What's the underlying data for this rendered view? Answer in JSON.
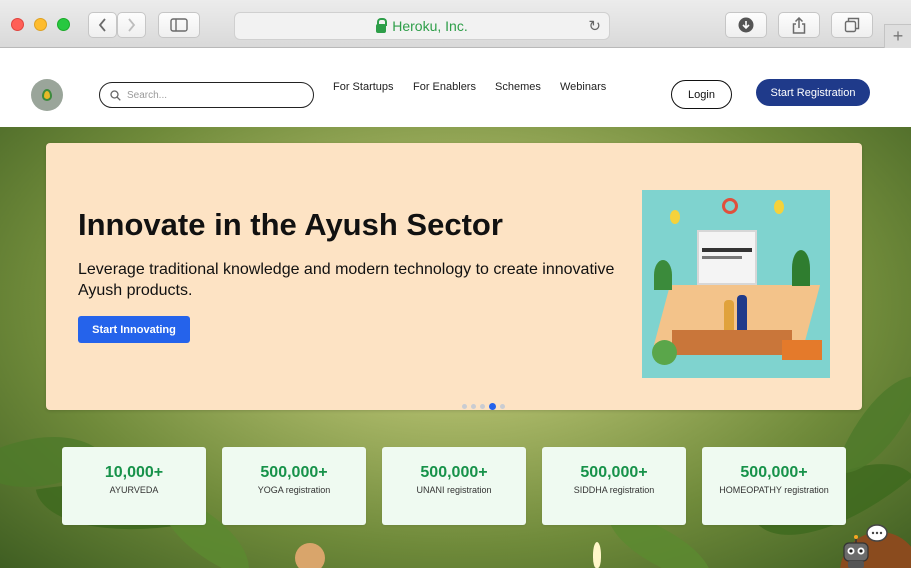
{
  "browser": {
    "address": "Heroku, Inc."
  },
  "header": {
    "search_placeholder": "Search...",
    "nav": [
      "For Startups",
      "For Enablers",
      "Schemes",
      "Webinars"
    ],
    "login_label": "Login",
    "register_label": "Start Registration"
  },
  "hero": {
    "title": "Innovate in the Ayush Sector",
    "description": "Leverage traditional knowledge and modern technology to create innovative Ayush products.",
    "cta_label": "Start Innovating",
    "slides_count": 5,
    "active_slide": 4
  },
  "stats": [
    {
      "value": "10,000+",
      "label": "AYURVEDA"
    },
    {
      "value": "500,000+",
      "label": "YOGA registration"
    },
    {
      "value": "500,000+",
      "label": "UNANI registration"
    },
    {
      "value": "500,000+",
      "label": "SIDDHA registration"
    },
    {
      "value": "500,000+",
      "label": "HOMEOPATHY registration"
    }
  ],
  "colors": {
    "primary_blue": "#2563eb",
    "navy": "#1f3a8a",
    "hero_bg": "#fde3c4",
    "stat_green": "#17924a"
  }
}
